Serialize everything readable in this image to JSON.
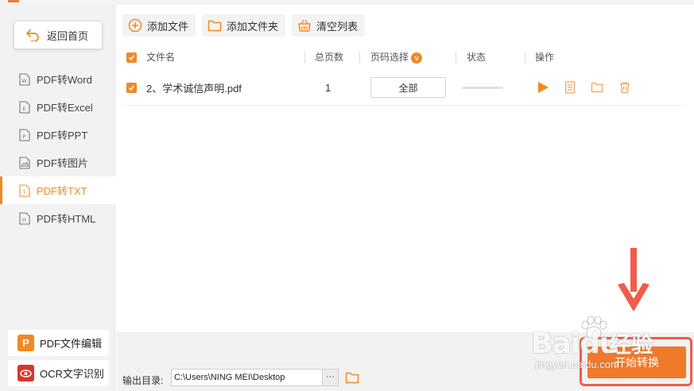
{
  "sidebar": {
    "back_label": "返回首页",
    "items": [
      {
        "label": "PDF转Word",
        "icon": "word-doc-icon",
        "glyph": "W",
        "active": false
      },
      {
        "label": "PDF转Excel",
        "icon": "excel-doc-icon",
        "glyph": "E",
        "active": false
      },
      {
        "label": "PDF转PPT",
        "icon": "ppt-doc-icon",
        "glyph": "P",
        "active": false
      },
      {
        "label": "PDF转图片",
        "icon": "image-doc-icon",
        "glyph": "",
        "active": false
      },
      {
        "label": "PDF转TXT",
        "icon": "txt-doc-icon",
        "glyph": "T",
        "active": true
      },
      {
        "label": "PDF转HTML",
        "icon": "html-doc-icon",
        "glyph": "H",
        "active": false
      }
    ],
    "tools": [
      {
        "label": "PDF文件编辑",
        "icon": "pdf-editor-icon",
        "glyph": "P",
        "color": "#f08a24"
      },
      {
        "label": "OCR文字识别",
        "icon": "ocr-eye-icon",
        "glyph": "",
        "color": "#d9342b"
      }
    ]
  },
  "toolbar": {
    "add_file": "添加文件",
    "add_folder": "添加文件夹",
    "clear_list": "清空列表"
  },
  "table": {
    "columns": {
      "name": "文件名",
      "pages": "总页数",
      "page_select": "页码选择",
      "status": "状态",
      "actions": "操作"
    },
    "rows": [
      {
        "name": "2、学术诚信声明.pdf",
        "pages": "1",
        "page_select": "全部",
        "progress": 0.0,
        "checked": true
      }
    ]
  },
  "output": {
    "label": "输出目录:",
    "path": "C:\\Users\\NING MEI\\Desktop",
    "browse": "···"
  },
  "start_button": "开始转换",
  "watermark": {
    "logo": "Baidu",
    "brand": "经验",
    "url": "jingyan.baidu.com"
  },
  "colors": {
    "accent": "#f08a24",
    "annotation": "#f25c4a",
    "ocr": "#d9342b"
  }
}
